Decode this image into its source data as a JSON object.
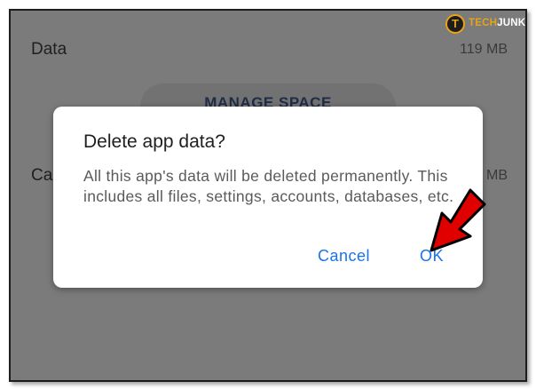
{
  "settings": {
    "data_label": "Data",
    "data_value": "119 MB",
    "manage_space_label": "MANAGE SPACE",
    "cache_label_partial": "Ca",
    "cache_value_partial": "MB"
  },
  "dialog": {
    "title": "Delete app data?",
    "body": "All this app's data will be deleted permanently. This includes all files, settings, accounts, databases, etc.",
    "cancel_label": "Cancel",
    "ok_label": "OK"
  },
  "watermark": {
    "prefix": "TECH",
    "suffix": "JUNKIE",
    "letter": "T"
  },
  "colors": {
    "accent_blue": "#1a73e8",
    "arrow_red": "#e00000",
    "logo_orange": "#e8a317"
  }
}
